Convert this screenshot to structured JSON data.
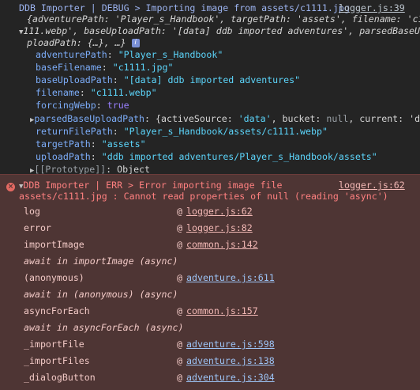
{
  "debug": {
    "prefix": "DDB Importer | DEBUG > Importing image from assets/c1111.jpg",
    "source_link": "logger.js:39",
    "preview_line1": "{adventurePath: 'Player_s_Handbook', targetPath: 'assets', filename: 'c1",
    "preview_line2": "111.webp', baseUploadPath: '[data] ddb imported adventures', parsedBaseU",
    "preview_line3": "ploadPath: {…}, …}",
    "info_icon": "i",
    "props": [
      {
        "key": "adventurePath",
        "value": "\"Player_s_Handbook\"",
        "type": "string"
      },
      {
        "key": "baseFilename",
        "value": "\"c1111.jpg\"",
        "type": "string"
      },
      {
        "key": "baseUploadPath",
        "value": "\"[data] ddb imported adventures\"",
        "type": "string"
      },
      {
        "key": "filename",
        "value": "\"c1111.webp\"",
        "type": "string"
      },
      {
        "key": "forcingWebp",
        "value": "true",
        "type": "bool"
      },
      {
        "key": "parsedBaseUploadPath",
        "value": "{activeSource: 'data', bucket: null, current: 'dd",
        "type": "object"
      },
      {
        "key": "returnFilePath",
        "value": "\"Player_s_Handbook/assets/c1111.webp\"",
        "type": "string"
      },
      {
        "key": "targetPath",
        "value": "\"assets\"",
        "type": "string"
      },
      {
        "key": "uploadPath",
        "value": "\"ddb imported adventures/Player_s_Handbook/assets\"",
        "type": "string"
      },
      {
        "key": "[[Prototype]]",
        "value": "Object",
        "type": "proto"
      }
    ]
  },
  "error": {
    "line1": "DDB Importer | ERR > Error importing image file",
    "source_link": "logger.js:62",
    "line2": "assets/c1111.jpg : Cannot read properties of null (reading 'async')",
    "stack": [
      {
        "fn": "log",
        "at": "@",
        "link": "logger.js:62",
        "async": false,
        "style": "gray"
      },
      {
        "fn": "error",
        "at": "@",
        "link": "logger.js:82",
        "async": false,
        "style": "gray"
      },
      {
        "fn": "importImage",
        "at": "@",
        "link": "common.js:142",
        "async": false,
        "style": "gray"
      },
      {
        "fn": "await in importImage (async)",
        "async": true
      },
      {
        "fn": "(anonymous)",
        "at": "@",
        "link": "adventure.js:611",
        "async": false,
        "style": "blue"
      },
      {
        "fn": "await in (anonymous) (async)",
        "async": true
      },
      {
        "fn": "asyncForEach",
        "at": "@",
        "link": "common.js:157",
        "async": false,
        "style": "gray"
      },
      {
        "fn": "await in asyncForEach (async)",
        "async": true
      },
      {
        "fn": "_importFile",
        "at": "@",
        "link": "adventure.js:598",
        "async": false,
        "style": "blue"
      },
      {
        "fn": "_importFiles",
        "at": "@",
        "link": "adventure.js:138",
        "async": false,
        "style": "blue"
      },
      {
        "fn": "_dialogButton",
        "at": "@",
        "link": "adventure.js:304",
        "async": false,
        "style": "blue"
      }
    ]
  },
  "colors": {
    "background": "#242424",
    "error_background": "#4e3534",
    "error_text": "#ff8080",
    "key": "#7cacf8",
    "string": "#5cd5fb",
    "bool": "#9980ff"
  }
}
